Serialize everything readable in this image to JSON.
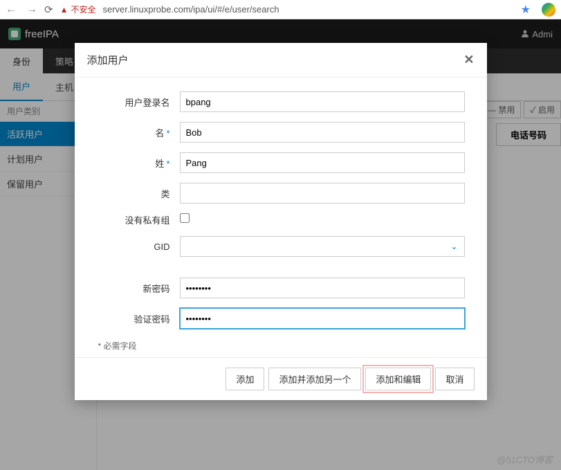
{
  "browser": {
    "insecure_label": "不安全",
    "url": "server.linuxprobe.com/ipa/ui/#/e/user/search"
  },
  "brand": "freeIPA",
  "admin_label": "Admi",
  "main_tabs": {
    "identity": "身份",
    "policy": "策略"
  },
  "sub_tabs": {
    "users": "用户",
    "hosts": "主机"
  },
  "sidebar": {
    "header": "用户类别",
    "items": [
      "活跃用户",
      "计划用户",
      "保留用户"
    ]
  },
  "action_buttons": {
    "disable": "禁用",
    "enable": "启用"
  },
  "table": {
    "col_phone": "电话号码"
  },
  "modal": {
    "title": "添加用户",
    "labels": {
      "login": "用户登录名",
      "first": "名",
      "last": "姓",
      "class": "类",
      "noprivate": "没有私有组",
      "gid": "GID",
      "newpass": "新密码",
      "verifypass": "验证密码"
    },
    "values": {
      "login": "bpang",
      "first": "Bob",
      "last": "Pang",
      "class": "",
      "gid": "",
      "newpass": "••••••••",
      "verifypass": "••••••••"
    },
    "required_note": "* 必需字段",
    "buttons": {
      "add": "添加",
      "add_another": "添加并添加另一个",
      "add_edit": "添加和编辑",
      "cancel": "取消"
    }
  },
  "watermark": "@51CTO博客"
}
